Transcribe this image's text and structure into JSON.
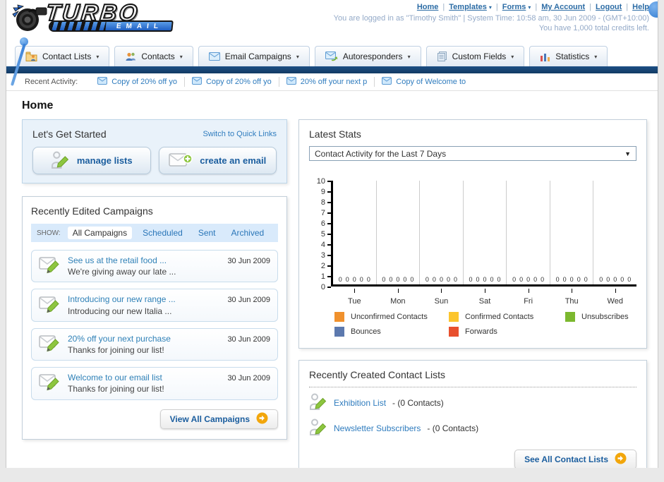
{
  "header": {
    "logo": {
      "title": "TURBO",
      "subtitle": "EMAIL"
    },
    "nav_links": [
      {
        "label": "Home",
        "dropdown": false
      },
      {
        "label": "Templates",
        "dropdown": true
      },
      {
        "label": "Forms",
        "dropdown": true
      },
      {
        "label": "My Account",
        "dropdown": false
      },
      {
        "label": "Logout",
        "dropdown": false
      },
      {
        "label": "Help",
        "dropdown": false
      }
    ],
    "login_line": "You are logged in as \"Timothy Smith\" | System Time: 10:58 am, 30 Jun 2009 - (GMT+10:00)",
    "credits_line": "You have 1,000 total credits left."
  },
  "main_nav": {
    "tabs": [
      {
        "label": "Contact Lists",
        "icon": "contact-lists-icon"
      },
      {
        "label": "Contacts",
        "icon": "contacts-icon"
      },
      {
        "label": "Email Campaigns",
        "icon": "email-campaigns-icon"
      },
      {
        "label": "Autoresponders",
        "icon": "autoresponders-icon"
      },
      {
        "label": "Custom Fields",
        "icon": "custom-fields-icon"
      },
      {
        "label": "Statistics",
        "icon": "statistics-icon"
      }
    ]
  },
  "recent_activity": {
    "label": "Recent Activity:",
    "items": [
      "Copy of 20% off yo",
      "Copy of 20% off yo",
      "20% off your next p",
      "Copy of Welcome to"
    ]
  },
  "page": {
    "title": "Home"
  },
  "get_started": {
    "title": "Let's Get Started",
    "switch_link": "Switch to Quick Links",
    "buttons": [
      {
        "label": "manage lists",
        "icon": "manage-lists-icon"
      },
      {
        "label": "create an email",
        "icon": "create-email-icon"
      }
    ]
  },
  "campaigns": {
    "title": "Recently Edited Campaigns",
    "show_label": "SHOW:",
    "filters": [
      {
        "label": "All Campaigns",
        "active": true
      },
      {
        "label": "Scheduled",
        "active": false
      },
      {
        "label": "Sent",
        "active": false
      },
      {
        "label": "Archived",
        "active": false
      }
    ],
    "rows": [
      {
        "title": "See us at the retail food ...",
        "subtitle": "We're giving away our late ...",
        "date": "30 Jun 2009"
      },
      {
        "title": "Introducing our new range ...",
        "subtitle": "Introducing our new Italia ...",
        "date": "30 Jun 2009"
      },
      {
        "title": "20% off your next purchase",
        "subtitle": "Thanks for joining our list!",
        "date": "30 Jun 2009"
      },
      {
        "title": "Welcome to our email list",
        "subtitle": "Thanks for joining our list!",
        "date": "30 Jun 2009"
      }
    ],
    "view_all_label": "View All Campaigns"
  },
  "stats": {
    "title": "Latest Stats",
    "dropdown_value": "Contact Activity for the Last 7 Days"
  },
  "chart_data": {
    "type": "bar",
    "title": "Contact Activity for the Last 7 Days",
    "categories": [
      "Tue",
      "Mon",
      "Sun",
      "Sat",
      "Fri",
      "Thu",
      "Wed"
    ],
    "series": [
      {
        "name": "Unconfirmed Contacts",
        "color": "#f0912d",
        "values": [
          0,
          0,
          0,
          0,
          0,
          0,
          0
        ]
      },
      {
        "name": "Confirmed Contacts",
        "color": "#fcc52d",
        "values": [
          0,
          0,
          0,
          0,
          0,
          0,
          0
        ]
      },
      {
        "name": "Unsubscribes",
        "color": "#7cb82f",
        "values": [
          0,
          0,
          0,
          0,
          0,
          0,
          0
        ]
      },
      {
        "name": "Bounces",
        "color": "#5c79ae",
        "values": [
          0,
          0,
          0,
          0,
          0,
          0,
          0
        ]
      },
      {
        "name": "Forwards",
        "color": "#e8502e",
        "values": [
          0,
          0,
          0,
          0,
          0,
          0,
          0
        ]
      }
    ],
    "xlabel": "",
    "ylabel": "",
    "ylim": [
      0,
      10
    ],
    "y_ticks": [
      0,
      1,
      2,
      3,
      4,
      5,
      6,
      7,
      8,
      9,
      10
    ],
    "grid": "vertical-only",
    "legend_position": "bottom"
  },
  "contact_lists": {
    "title": "Recently Created Contact Lists",
    "items": [
      {
        "name": "Exhibition List",
        "suffix": "- (0 Contacts)"
      },
      {
        "name": "Newsletter Subscribers",
        "suffix": "- (0 Contacts)"
      }
    ],
    "see_all_label": "See All Contact Lists"
  }
}
